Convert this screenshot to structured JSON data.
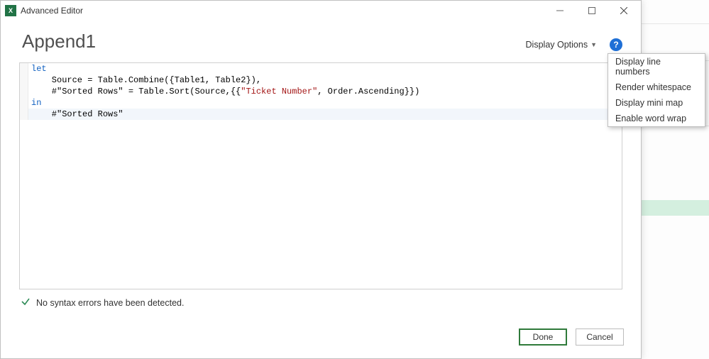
{
  "titlebar": {
    "icon_text": "X",
    "title": "Advanced Editor"
  },
  "header": {
    "page_title": "Append1",
    "display_options_label": "Display Options"
  },
  "editor": {
    "lines": [
      {
        "tokens": [
          {
            "t": "kw",
            "v": "let"
          }
        ]
      },
      {
        "tokens": [
          {
            "t": "",
            "v": "    Source = Table.Combine({Table1, Table2}),"
          }
        ]
      },
      {
        "tokens": [
          {
            "t": "",
            "v": "    #\"Sorted Rows\" = Table.Sort(Source,{{"
          },
          {
            "t": "str",
            "v": "\"Ticket Number\""
          },
          {
            "t": "",
            "v": ", Order.Ascending}})"
          }
        ]
      },
      {
        "tokens": [
          {
            "t": "kw",
            "v": "in"
          }
        ]
      },
      {
        "tokens": [
          {
            "t": "",
            "v": "    #\"Sorted Rows\""
          }
        ],
        "hl": true
      }
    ]
  },
  "status": {
    "message": "No syntax errors have been detected."
  },
  "footer": {
    "done_label": "Done",
    "cancel_label": "Cancel"
  },
  "dropdown": {
    "items": [
      "Display line numbers",
      "Render whitespace",
      "Display mini map",
      "Enable word wrap"
    ]
  }
}
